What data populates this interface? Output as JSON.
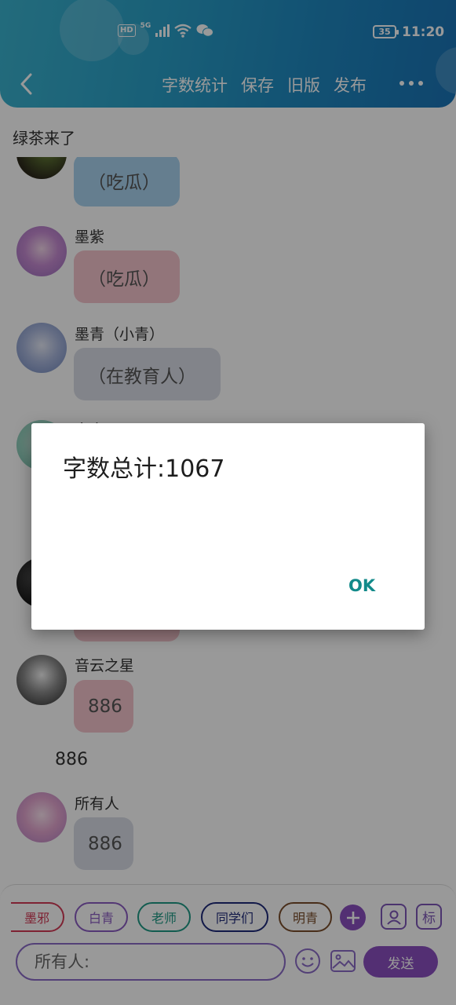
{
  "status_bar": {
    "hd": "HD",
    "network": "5G",
    "battery": "35",
    "time": "11:20"
  },
  "nav": {
    "actions": [
      "字数统计",
      "保存",
      "旧版",
      "发布"
    ]
  },
  "chat": {
    "title": "绿茶来了",
    "messages": [
      {
        "sender": "",
        "text": "（吃瓜）",
        "bubble_color": "#a9d2ee"
      },
      {
        "sender": "墨紫",
        "text": "（吃瓜）",
        "bubble_color": "#f4c4cc"
      },
      {
        "sender": "墨青（小青）",
        "text": "（在教育人）",
        "bubble_color": "#d9dde6"
      },
      {
        "sender": "白青",
        "text": "",
        "bubble_color": "#f4c4cc"
      },
      {
        "sender": "",
        "text": "",
        "bubble_color": "#f4c4cc"
      },
      {
        "sender": "音云之星",
        "text": "886",
        "bubble_color": "#f4c4cc"
      },
      {
        "sender": "",
        "plain_text": "886"
      },
      {
        "sender": "所有人",
        "text": "886",
        "bubble_color": "#d9dde6"
      }
    ]
  },
  "toolbar": {
    "chips": [
      {
        "label": "墨邪",
        "color": "#d23a55"
      },
      {
        "label": "白青",
        "color": "#8a5cc2"
      },
      {
        "label": "老师",
        "color": "#1f9a85"
      },
      {
        "label": "同学们",
        "color": "#1e2a7a"
      },
      {
        "label": "明青",
        "color": "#7a4e2c"
      }
    ],
    "mark_label": "标",
    "input_placeholder": "所有人:",
    "send_label": "发送"
  },
  "dialog": {
    "message": "字数总计:1067",
    "ok_label": "OK"
  },
  "colors": {
    "header_gradient_start": "#3bb3cf",
    "header_gradient_end": "#1a74b6",
    "accent": "#8a4fc0",
    "dialog_ok": "#128a8a"
  }
}
